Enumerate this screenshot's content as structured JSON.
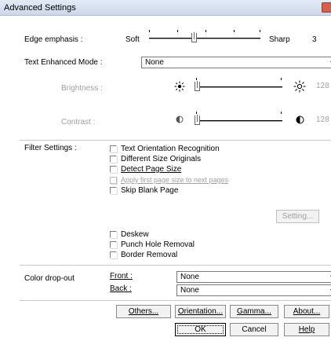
{
  "window": {
    "title": "Advanced Settings"
  },
  "edge_emphasis": {
    "label": "Edge emphasis :",
    "min_label": "Soft",
    "max_label": "Sharp",
    "value": "3",
    "level_fraction": 0.4
  },
  "text_enhanced": {
    "label": "Text Enhanced Mode :",
    "selected": "None"
  },
  "brightness": {
    "label": "Brightness :",
    "value": "128",
    "min_icon": "sun-small-icon",
    "max_icon": "sun-large-icon",
    "level_fraction": 0.0
  },
  "contrast": {
    "label": "Contrast :",
    "value": "128",
    "min_icon": "contrast-low-icon",
    "max_icon": "contrast-high-icon",
    "level_fraction": 0.0
  },
  "filter": {
    "label": "Filter Settings :",
    "checkboxes": [
      {
        "label": "Text Orientation Recognition",
        "checked": false,
        "enabled": true
      },
      {
        "label": "Different Size Originals",
        "checked": false,
        "enabled": true
      },
      {
        "label": "Detect Page Size",
        "checked": false,
        "enabled": true
      },
      {
        "label": "Apply first page size to next pages",
        "checked": false,
        "enabled": false
      },
      {
        "label": "Skip Blank Page",
        "checked": false,
        "enabled": true
      }
    ],
    "setting_button": "Setting...",
    "checkboxes2": [
      {
        "label": "Deskew",
        "checked": false,
        "enabled": true
      },
      {
        "label": "Punch Hole Removal",
        "checked": false,
        "enabled": true
      },
      {
        "label": "Border Removal",
        "checked": false,
        "enabled": true
      }
    ]
  },
  "color_dropout": {
    "label": "Color drop-out",
    "front_label": "Front :",
    "front_value": "None",
    "back_label": "Back :",
    "back_value": "None"
  },
  "buttons": {
    "others": "Others...",
    "orientation": "Orientation...",
    "gamma": "Gamma...",
    "about": "About...",
    "ok": "OK",
    "cancel": "Cancel",
    "help": "Help"
  }
}
